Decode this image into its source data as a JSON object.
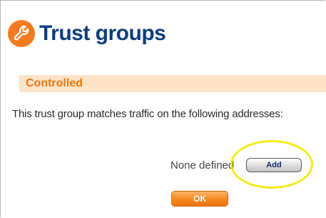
{
  "page": {
    "title": "Trust groups",
    "title_icon": "wrench-icon"
  },
  "section": {
    "label": "Controlled",
    "description": "This trust group matches traffic on the following addresses:"
  },
  "addresses": {
    "empty_text": "None defined",
    "add_label": "Add"
  },
  "actions": {
    "ok_label": "OK"
  },
  "colors": {
    "brand_orange": "#f47a1f",
    "title_blue": "#0c3d7d",
    "section_bg": "#fde4c8",
    "section_text": "#e87612",
    "highlight_yellow": "#f2ec1b"
  }
}
